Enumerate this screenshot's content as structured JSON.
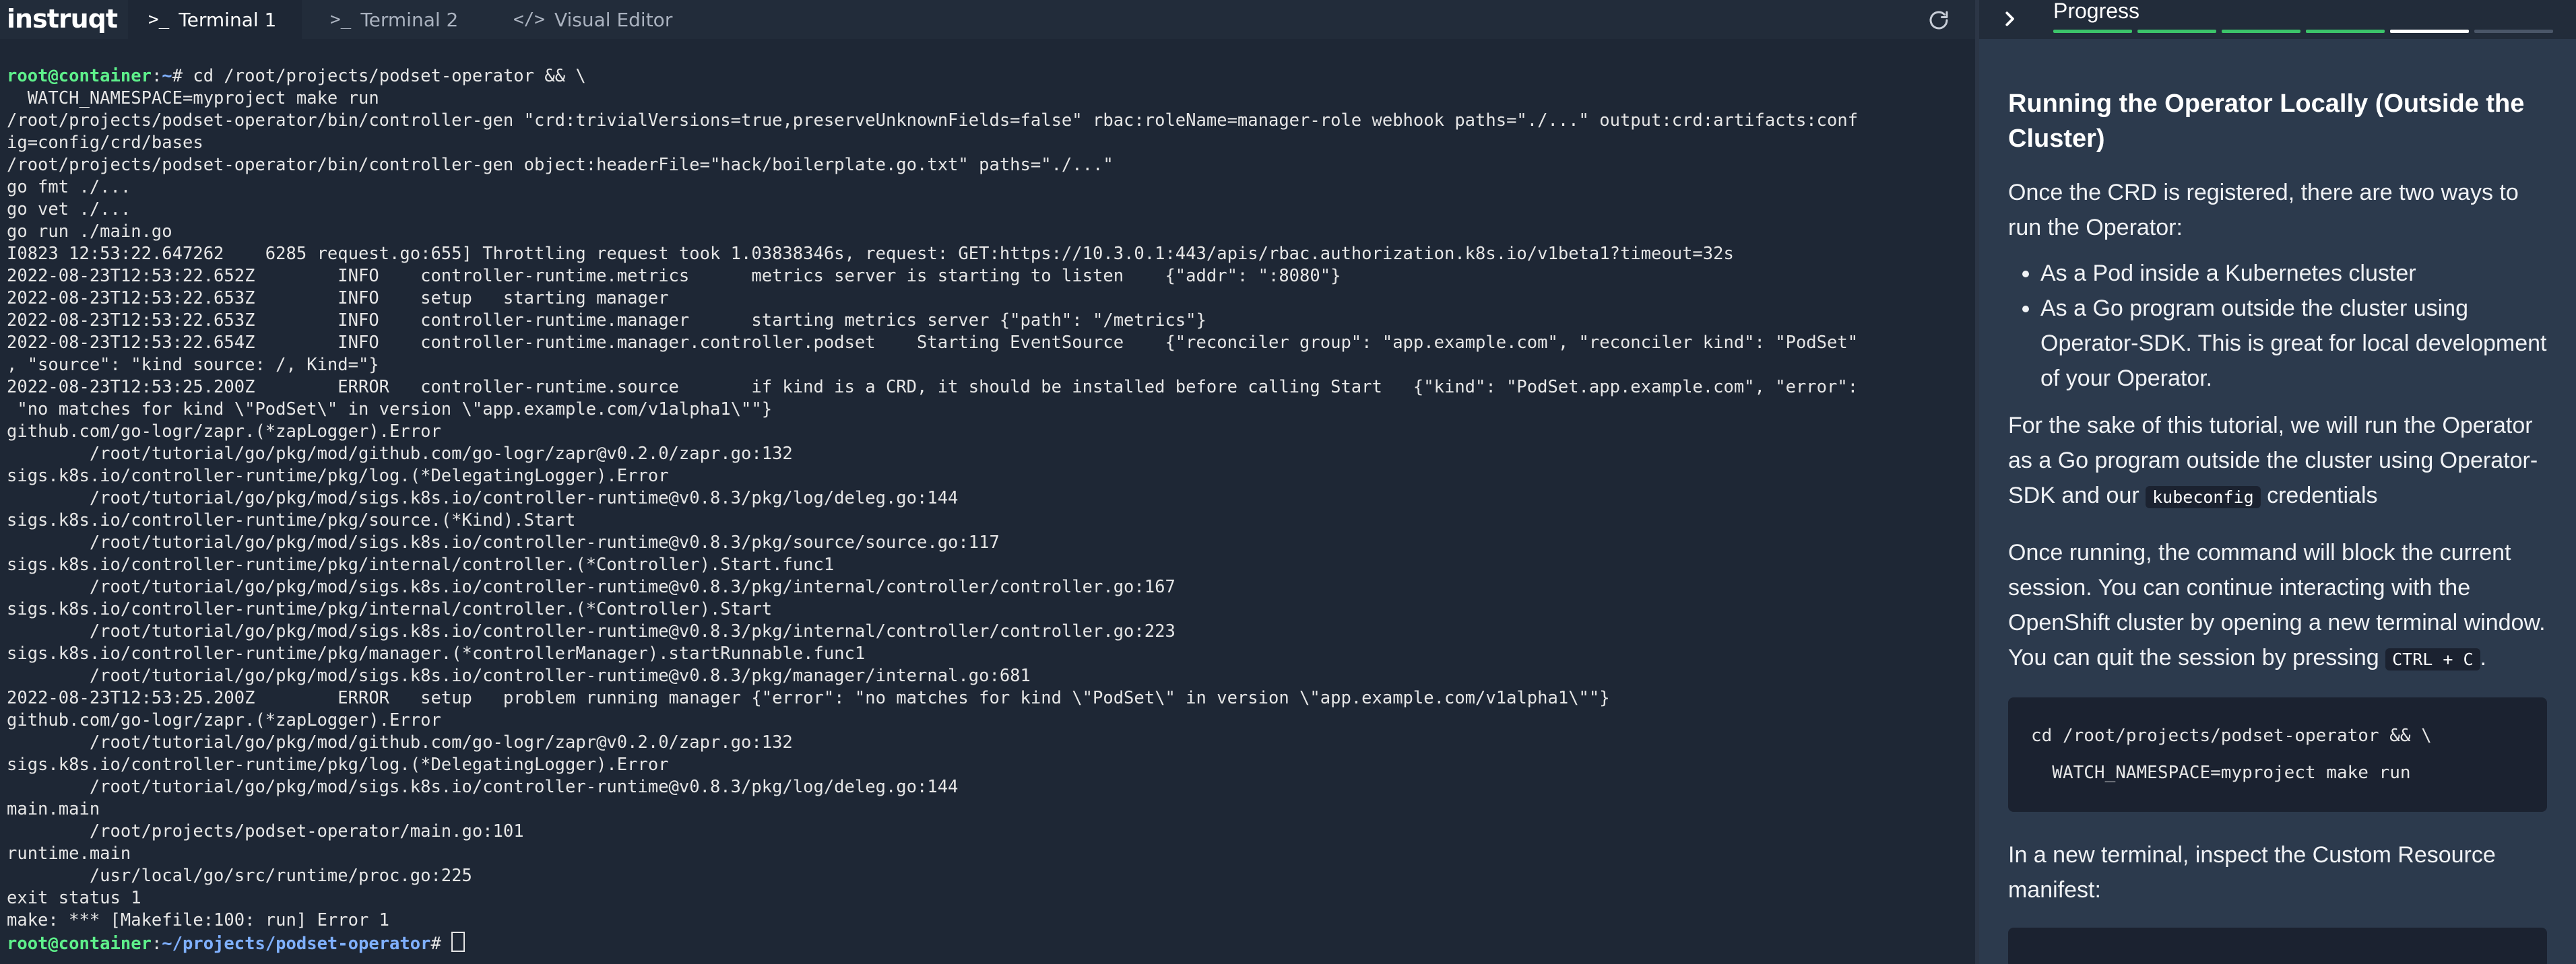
{
  "app": {
    "logo": "instruqt"
  },
  "tabs": [
    {
      "icon": ">_",
      "label": "Terminal 1"
    },
    {
      "icon": ">_",
      "label": "Terminal 2"
    },
    {
      "icon": "</>",
      "label": "Visual Editor"
    }
  ],
  "terminal": {
    "prompt1": {
      "user": "root@container",
      "sep": ":",
      "path": "~",
      "symbol": "# ",
      "command": "cd /root/projects/podset-operator && \\"
    },
    "lines": [
      "  WATCH_NAMESPACE=myproject make run",
      "/root/projects/podset-operator/bin/controller-gen \"crd:trivialVersions=true,preserveUnknownFields=false\" rbac:roleName=manager-role webhook paths=\"./...\" output:crd:artifacts:conf",
      "ig=config/crd/bases",
      "/root/projects/podset-operator/bin/controller-gen object:headerFile=\"hack/boilerplate.go.txt\" paths=\"./...\"",
      "go fmt ./...",
      "go vet ./...",
      "go run ./main.go",
      "I0823 12:53:22.647262    6285 request.go:655] Throttling request took 1.03838346s, request: GET:https://10.3.0.1:443/apis/rbac.authorization.k8s.io/v1beta1?timeout=32s",
      "2022-08-23T12:53:22.652Z        INFO    controller-runtime.metrics      metrics server is starting to listen    {\"addr\": \":8080\"}",
      "2022-08-23T12:53:22.653Z        INFO    setup   starting manager",
      "2022-08-23T12:53:22.653Z        INFO    controller-runtime.manager      starting metrics server {\"path\": \"/metrics\"}",
      "2022-08-23T12:53:22.654Z        INFO    controller-runtime.manager.controller.podset    Starting EventSource    {\"reconciler group\": \"app.example.com\", \"reconciler kind\": \"PodSet\"",
      ", \"source\": \"kind source: /, Kind=\"}",
      "2022-08-23T12:53:25.200Z        ERROR   controller-runtime.source       if kind is a CRD, it should be installed before calling Start   {\"kind\": \"PodSet.app.example.com\", \"error\":",
      " \"no matches for kind \\\"PodSet\\\" in version \\\"app.example.com/v1alpha1\\\"\"}",
      "github.com/go-logr/zapr.(*zapLogger).Error",
      "        /root/tutorial/go/pkg/mod/github.com/go-logr/zapr@v0.2.0/zapr.go:132",
      "sigs.k8s.io/controller-runtime/pkg/log.(*DelegatingLogger).Error",
      "        /root/tutorial/go/pkg/mod/sigs.k8s.io/controller-runtime@v0.8.3/pkg/log/deleg.go:144",
      "sigs.k8s.io/controller-runtime/pkg/source.(*Kind).Start",
      "        /root/tutorial/go/pkg/mod/sigs.k8s.io/controller-runtime@v0.8.3/pkg/source/source.go:117",
      "sigs.k8s.io/controller-runtime/pkg/internal/controller.(*Controller).Start.func1",
      "        /root/tutorial/go/pkg/mod/sigs.k8s.io/controller-runtime@v0.8.3/pkg/internal/controller/controller.go:167",
      "sigs.k8s.io/controller-runtime/pkg/internal/controller.(*Controller).Start",
      "        /root/tutorial/go/pkg/mod/sigs.k8s.io/controller-runtime@v0.8.3/pkg/internal/controller/controller.go:223",
      "sigs.k8s.io/controller-runtime/pkg/manager.(*controllerManager).startRunnable.func1",
      "        /root/tutorial/go/pkg/mod/sigs.k8s.io/controller-runtime@v0.8.3/pkg/manager/internal.go:681",
      "2022-08-23T12:53:25.200Z        ERROR   setup   problem running manager {\"error\": \"no matches for kind \\\"PodSet\\\" in version \\\"app.example.com/v1alpha1\\\"\"}",
      "github.com/go-logr/zapr.(*zapLogger).Error",
      "        /root/tutorial/go/pkg/mod/github.com/go-logr/zapr@v0.2.0/zapr.go:132",
      "sigs.k8s.io/controller-runtime/pkg/log.(*DelegatingLogger).Error",
      "        /root/tutorial/go/pkg/mod/sigs.k8s.io/controller-runtime@v0.8.3/pkg/log/deleg.go:144",
      "main.main",
      "        /root/projects/podset-operator/main.go:101",
      "runtime.main",
      "        /usr/local/go/src/runtime/proc.go:225",
      "exit status 1",
      "make: *** [Makefile:100: run] Error 1"
    ],
    "prompt2": {
      "user": "root@container",
      "sep": ":",
      "path": "~/projects/podset-operator",
      "symbol": "# "
    }
  },
  "sidebar": {
    "progress_label": "Progress",
    "progress": {
      "completed": 4,
      "current": 5,
      "total": 6
    },
    "title": "Running the Operator Locally (Outside the Cluster)",
    "intro": "Once the CRD is registered, there are two ways to run the Operator:",
    "bullets": [
      "As a Pod inside a Kubernetes cluster",
      "As a Go program outside the cluster using Operator-SDK. This is great for local development of your Operator."
    ],
    "para2_before": "For the sake of this tutorial, we will run the Operator as a Go program outside the cluster using Operator-SDK and our ",
    "para2_code": "kubeconfig",
    "para2_after": " credentials",
    "para3_before": "Once running, the command will block the current session. You can continue interacting with the OpenShift cluster by opening a new terminal window. You can quit the session by pressing ",
    "para3_code": "CTRL + C",
    "para3_after": ".",
    "code_block": "cd /root/projects/podset-operator && \\\n  WATCH_NAMESPACE=myproject make run",
    "para4": "In a new terminal, inspect the Custom Resource manifest:"
  },
  "colors": {
    "terminal_bg": "#1e2735",
    "sidebar_bg": "#2c3a4d",
    "prompt_user": "#5ef08b",
    "prompt_path": "#7fb0ff",
    "progress_done": "#3cc46a",
    "progress_current": "#ffffff",
    "progress_todo": "#4a5668"
  },
  "icons": {
    "refresh": "refresh-icon",
    "collapse": "chevron-right-icon"
  }
}
